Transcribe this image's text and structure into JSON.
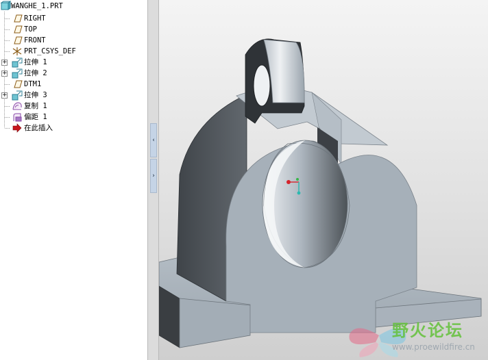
{
  "model_tree": {
    "items": [
      {
        "label": "WANGHE_1.PRT",
        "icon": "part-icon",
        "expander": ""
      },
      {
        "label": "RIGHT",
        "icon": "datum-plane-icon",
        "expander": ""
      },
      {
        "label": "TOP",
        "icon": "datum-plane-icon",
        "expander": ""
      },
      {
        "label": "FRONT",
        "icon": "datum-plane-icon",
        "expander": ""
      },
      {
        "label": "PRT_CSYS_DEF",
        "icon": "csys-icon",
        "expander": ""
      },
      {
        "label": "拉伸 1",
        "icon": "extrude-icon",
        "expander": "+"
      },
      {
        "label": "拉伸 2",
        "icon": "extrude-icon",
        "expander": "+"
      },
      {
        "label": "DTM1",
        "icon": "datum-plane-icon",
        "expander": ""
      },
      {
        "label": "拉伸 3",
        "icon": "extrude-icon",
        "expander": "+"
      },
      {
        "label": "复制 1",
        "icon": "copy-icon",
        "expander": ""
      },
      {
        "label": "偏距 1",
        "icon": "offset-icon",
        "expander": ""
      },
      {
        "label": "在此插入",
        "icon": "insert-here-arrow-icon",
        "expander": ""
      }
    ]
  },
  "splitter": {
    "collapse_glyph": "‹",
    "expand_glyph": "›"
  },
  "viewport": {
    "watermark_title": "野火论坛",
    "watermark_url": "www.proewildfire.cn"
  },
  "colors": {
    "model_light": "#a9b3bd",
    "model_dark": "#4a4f55",
    "watermark_green": "#63c13a",
    "insert_arrow": "#c8161d"
  }
}
